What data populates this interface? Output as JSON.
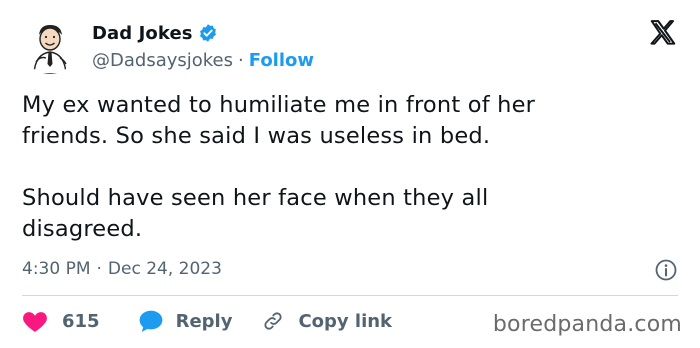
{
  "author": {
    "display_name": "Dad Jokes",
    "handle": "@Dadsaysjokes",
    "separator": "·",
    "follow_label": "Follow",
    "verified": true
  },
  "tweet": {
    "text": "My ex wanted to humiliate me in front of her\nfriends. So she said I was useless in bed.\n\nShould have seen her face when they all\ndisagreed."
  },
  "meta": {
    "time": "4:30 PM",
    "separator": "·",
    "date": "Dec 24, 2023"
  },
  "actions": {
    "like_count": "615",
    "reply_label": "Reply",
    "copy_link_label": "Copy link"
  },
  "watermark": "boredpanda.com",
  "colors": {
    "accent": "#1d9bf0",
    "like": "#f91880",
    "text": "#0f1419",
    "secondary": "#536471"
  },
  "icons": {
    "verified": "verified-badge-icon",
    "platform": "x-logo-icon",
    "info": "info-icon",
    "like": "heart-icon",
    "reply": "speech-bubble-icon",
    "copy": "link-icon"
  }
}
